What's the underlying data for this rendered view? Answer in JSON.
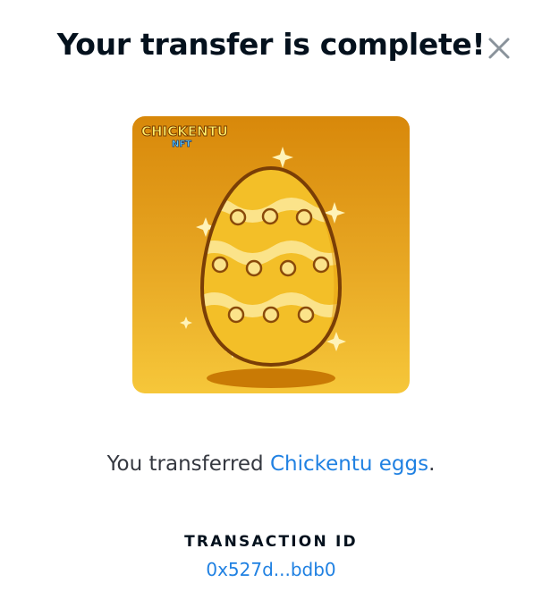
{
  "modal": {
    "title": "Your transfer is complete!",
    "close_icon": "close-icon"
  },
  "nft": {
    "logo_line1": "CHICKENTU",
    "logo_line2": "NFT",
    "image_icon": "golden-egg-icon",
    "background_color": "#e3a21a"
  },
  "message": {
    "prefix": "You transferred ",
    "item_link": "Chickentu eggs",
    "suffix": "."
  },
  "transaction": {
    "label": "TRANSACTION ID",
    "id": "0x527d...bdb0"
  },
  "colors": {
    "link": "#2081e2",
    "heading": "#04111d",
    "body_text": "#353840"
  }
}
